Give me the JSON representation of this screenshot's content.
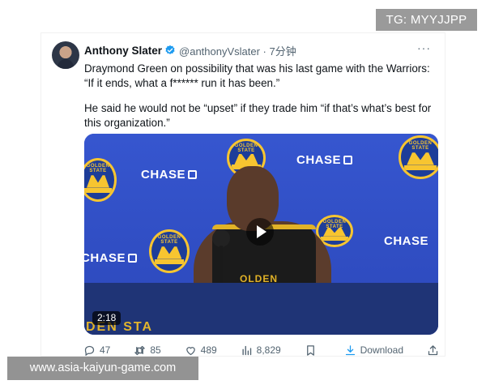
{
  "tweet": {
    "display_name": "Anthony Slater",
    "handle_and_time": "@anthonyVslater · 7分钟",
    "more_label": "···",
    "paragraph1": "Draymond Green on possibility that was his last game with the Warriors: “If it ends, what a f****** run it has been.”",
    "paragraph2": "He said he would not be “upset” if they trade him “if that’s what’s best for this organization.”"
  },
  "media": {
    "sponsor_text": "CHASE",
    "logo_text": "GOLDEN STATE",
    "logo_banner": "WARRIORS",
    "jersey_text": "OLDEN",
    "podium_text": "DEN STA",
    "duration": "2:18"
  },
  "actions": {
    "replies": "47",
    "reposts": "85",
    "likes": "489",
    "views": "8,829",
    "download_label": "Download"
  },
  "overlays": {
    "top_right": "TG: MYYJJPP",
    "bottom_left": "www.asia-kaiyun-game.com"
  },
  "colors": {
    "verified": "#1d9bf0",
    "secondary_text": "#536471",
    "warriors_blue": "#2f4fc4",
    "warriors_gold": "#f7c530"
  },
  "icons": [
    "verified-badge-icon",
    "more-icon",
    "play-icon",
    "reply-icon",
    "repost-icon",
    "like-icon",
    "views-icon",
    "bookmark-icon",
    "download-icon",
    "share-icon"
  ]
}
